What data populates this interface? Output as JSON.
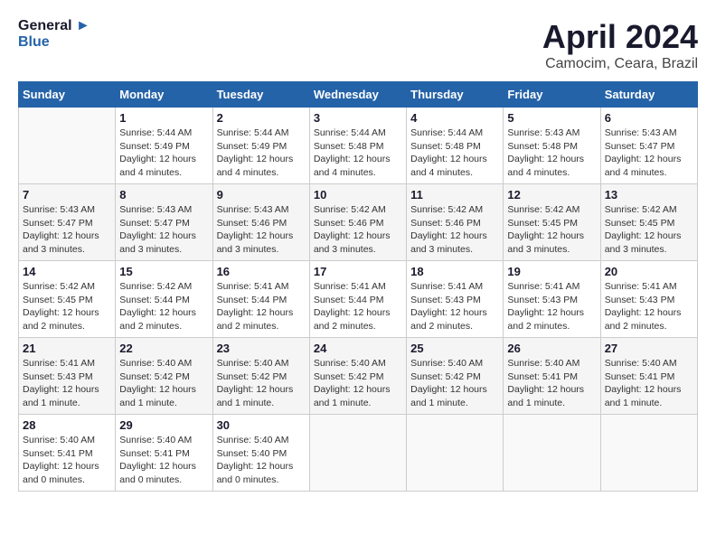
{
  "header": {
    "logo_line1": "General",
    "logo_line2": "Blue",
    "month_title": "April 2024",
    "subtitle": "Camocim, Ceara, Brazil"
  },
  "weekdays": [
    "Sunday",
    "Monday",
    "Tuesday",
    "Wednesday",
    "Thursday",
    "Friday",
    "Saturday"
  ],
  "weeks": [
    [
      {
        "day": "",
        "info": ""
      },
      {
        "day": "1",
        "info": "Sunrise: 5:44 AM\nSunset: 5:49 PM\nDaylight: 12 hours\nand 4 minutes."
      },
      {
        "day": "2",
        "info": "Sunrise: 5:44 AM\nSunset: 5:49 PM\nDaylight: 12 hours\nand 4 minutes."
      },
      {
        "day": "3",
        "info": "Sunrise: 5:44 AM\nSunset: 5:48 PM\nDaylight: 12 hours\nand 4 minutes."
      },
      {
        "day": "4",
        "info": "Sunrise: 5:44 AM\nSunset: 5:48 PM\nDaylight: 12 hours\nand 4 minutes."
      },
      {
        "day": "5",
        "info": "Sunrise: 5:43 AM\nSunset: 5:48 PM\nDaylight: 12 hours\nand 4 minutes."
      },
      {
        "day": "6",
        "info": "Sunrise: 5:43 AM\nSunset: 5:47 PM\nDaylight: 12 hours\nand 4 minutes."
      }
    ],
    [
      {
        "day": "7",
        "info": "Sunrise: 5:43 AM\nSunset: 5:47 PM\nDaylight: 12 hours\nand 3 minutes."
      },
      {
        "day": "8",
        "info": "Sunrise: 5:43 AM\nSunset: 5:47 PM\nDaylight: 12 hours\nand 3 minutes."
      },
      {
        "day": "9",
        "info": "Sunrise: 5:43 AM\nSunset: 5:46 PM\nDaylight: 12 hours\nand 3 minutes."
      },
      {
        "day": "10",
        "info": "Sunrise: 5:42 AM\nSunset: 5:46 PM\nDaylight: 12 hours\nand 3 minutes."
      },
      {
        "day": "11",
        "info": "Sunrise: 5:42 AM\nSunset: 5:46 PM\nDaylight: 12 hours\nand 3 minutes."
      },
      {
        "day": "12",
        "info": "Sunrise: 5:42 AM\nSunset: 5:45 PM\nDaylight: 12 hours\nand 3 minutes."
      },
      {
        "day": "13",
        "info": "Sunrise: 5:42 AM\nSunset: 5:45 PM\nDaylight: 12 hours\nand 3 minutes."
      }
    ],
    [
      {
        "day": "14",
        "info": "Sunrise: 5:42 AM\nSunset: 5:45 PM\nDaylight: 12 hours\nand 2 minutes."
      },
      {
        "day": "15",
        "info": "Sunrise: 5:42 AM\nSunset: 5:44 PM\nDaylight: 12 hours\nand 2 minutes."
      },
      {
        "day": "16",
        "info": "Sunrise: 5:41 AM\nSunset: 5:44 PM\nDaylight: 12 hours\nand 2 minutes."
      },
      {
        "day": "17",
        "info": "Sunrise: 5:41 AM\nSunset: 5:44 PM\nDaylight: 12 hours\nand 2 minutes."
      },
      {
        "day": "18",
        "info": "Sunrise: 5:41 AM\nSunset: 5:43 PM\nDaylight: 12 hours\nand 2 minutes."
      },
      {
        "day": "19",
        "info": "Sunrise: 5:41 AM\nSunset: 5:43 PM\nDaylight: 12 hours\nand 2 minutes."
      },
      {
        "day": "20",
        "info": "Sunrise: 5:41 AM\nSunset: 5:43 PM\nDaylight: 12 hours\nand 2 minutes."
      }
    ],
    [
      {
        "day": "21",
        "info": "Sunrise: 5:41 AM\nSunset: 5:43 PM\nDaylight: 12 hours\nand 1 minute."
      },
      {
        "day": "22",
        "info": "Sunrise: 5:40 AM\nSunset: 5:42 PM\nDaylight: 12 hours\nand 1 minute."
      },
      {
        "day": "23",
        "info": "Sunrise: 5:40 AM\nSunset: 5:42 PM\nDaylight: 12 hours\nand 1 minute."
      },
      {
        "day": "24",
        "info": "Sunrise: 5:40 AM\nSunset: 5:42 PM\nDaylight: 12 hours\nand 1 minute."
      },
      {
        "day": "25",
        "info": "Sunrise: 5:40 AM\nSunset: 5:42 PM\nDaylight: 12 hours\nand 1 minute."
      },
      {
        "day": "26",
        "info": "Sunrise: 5:40 AM\nSunset: 5:41 PM\nDaylight: 12 hours\nand 1 minute."
      },
      {
        "day": "27",
        "info": "Sunrise: 5:40 AM\nSunset: 5:41 PM\nDaylight: 12 hours\nand 1 minute."
      }
    ],
    [
      {
        "day": "28",
        "info": "Sunrise: 5:40 AM\nSunset: 5:41 PM\nDaylight: 12 hours\nand 0 minutes."
      },
      {
        "day": "29",
        "info": "Sunrise: 5:40 AM\nSunset: 5:41 PM\nDaylight: 12 hours\nand 0 minutes."
      },
      {
        "day": "30",
        "info": "Sunrise: 5:40 AM\nSunset: 5:40 PM\nDaylight: 12 hours\nand 0 minutes."
      },
      {
        "day": "",
        "info": ""
      },
      {
        "day": "",
        "info": ""
      },
      {
        "day": "",
        "info": ""
      },
      {
        "day": "",
        "info": ""
      }
    ]
  ]
}
